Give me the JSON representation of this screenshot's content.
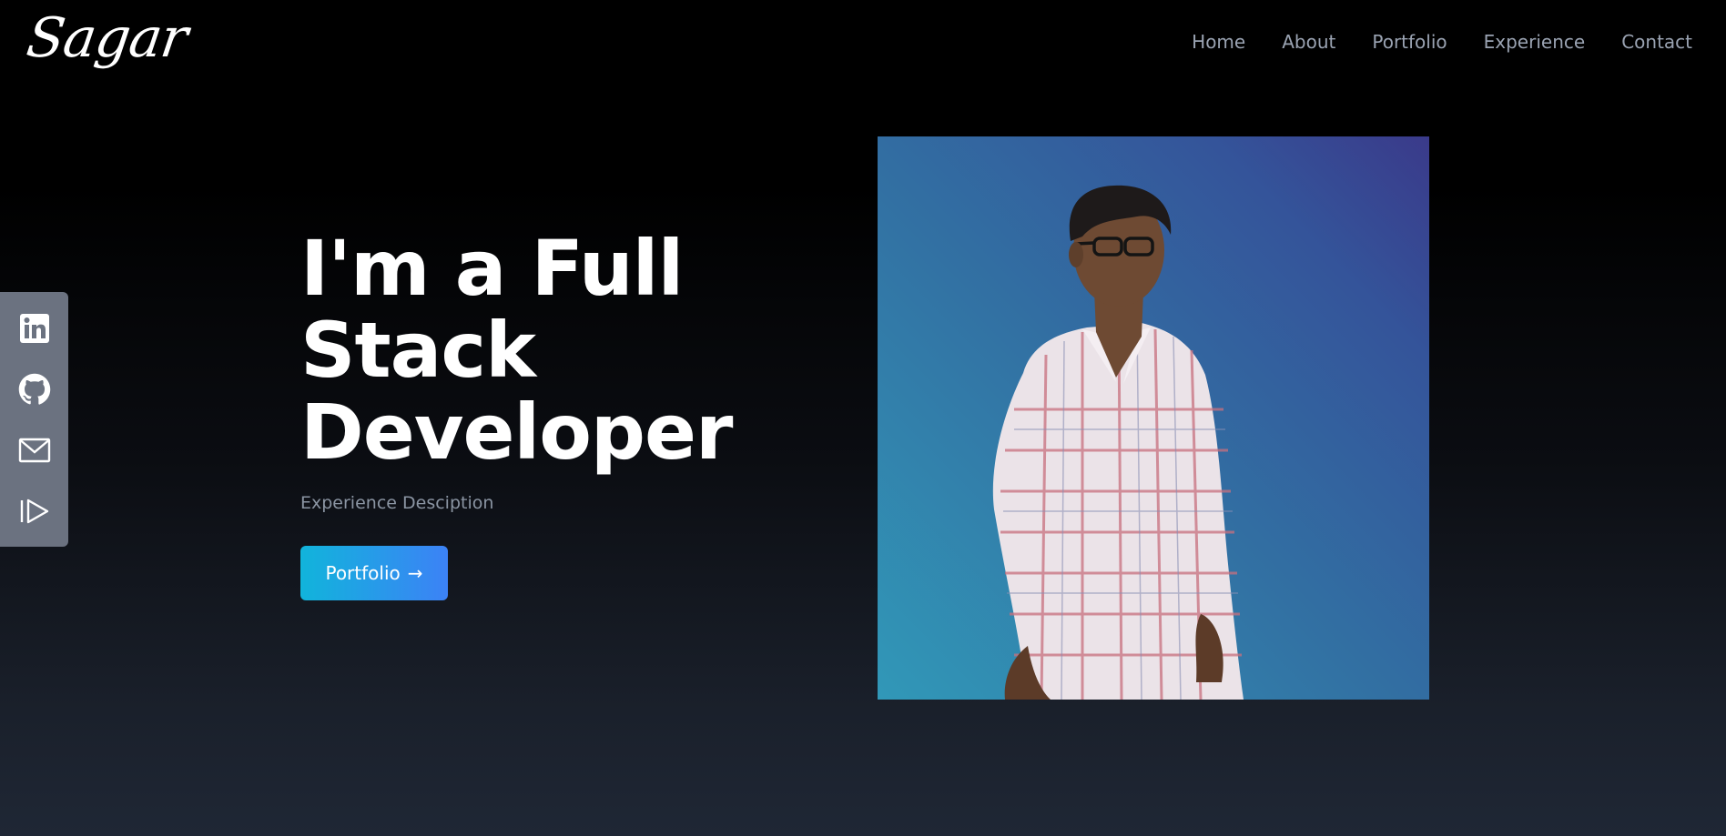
{
  "header": {
    "logo": "Sagar",
    "nav": [
      "Home",
      "About",
      "Portfolio",
      "Experience",
      "Contact"
    ]
  },
  "social": {
    "items": [
      "linkedin-icon",
      "github-icon",
      "mail-icon",
      "resume-play-icon"
    ]
  },
  "hero": {
    "title_line1": "I'm a Full",
    "title_line2": "Stack",
    "title_line3": "Developer",
    "description": "Experience Desciption",
    "cta_label": "Portfolio",
    "cta_arrow": "→"
  },
  "colors": {
    "accent_start": "#11b4db",
    "accent_end": "#3c82f6",
    "nav_text": "#9aa3b2",
    "social_bar": "#6b7280"
  }
}
